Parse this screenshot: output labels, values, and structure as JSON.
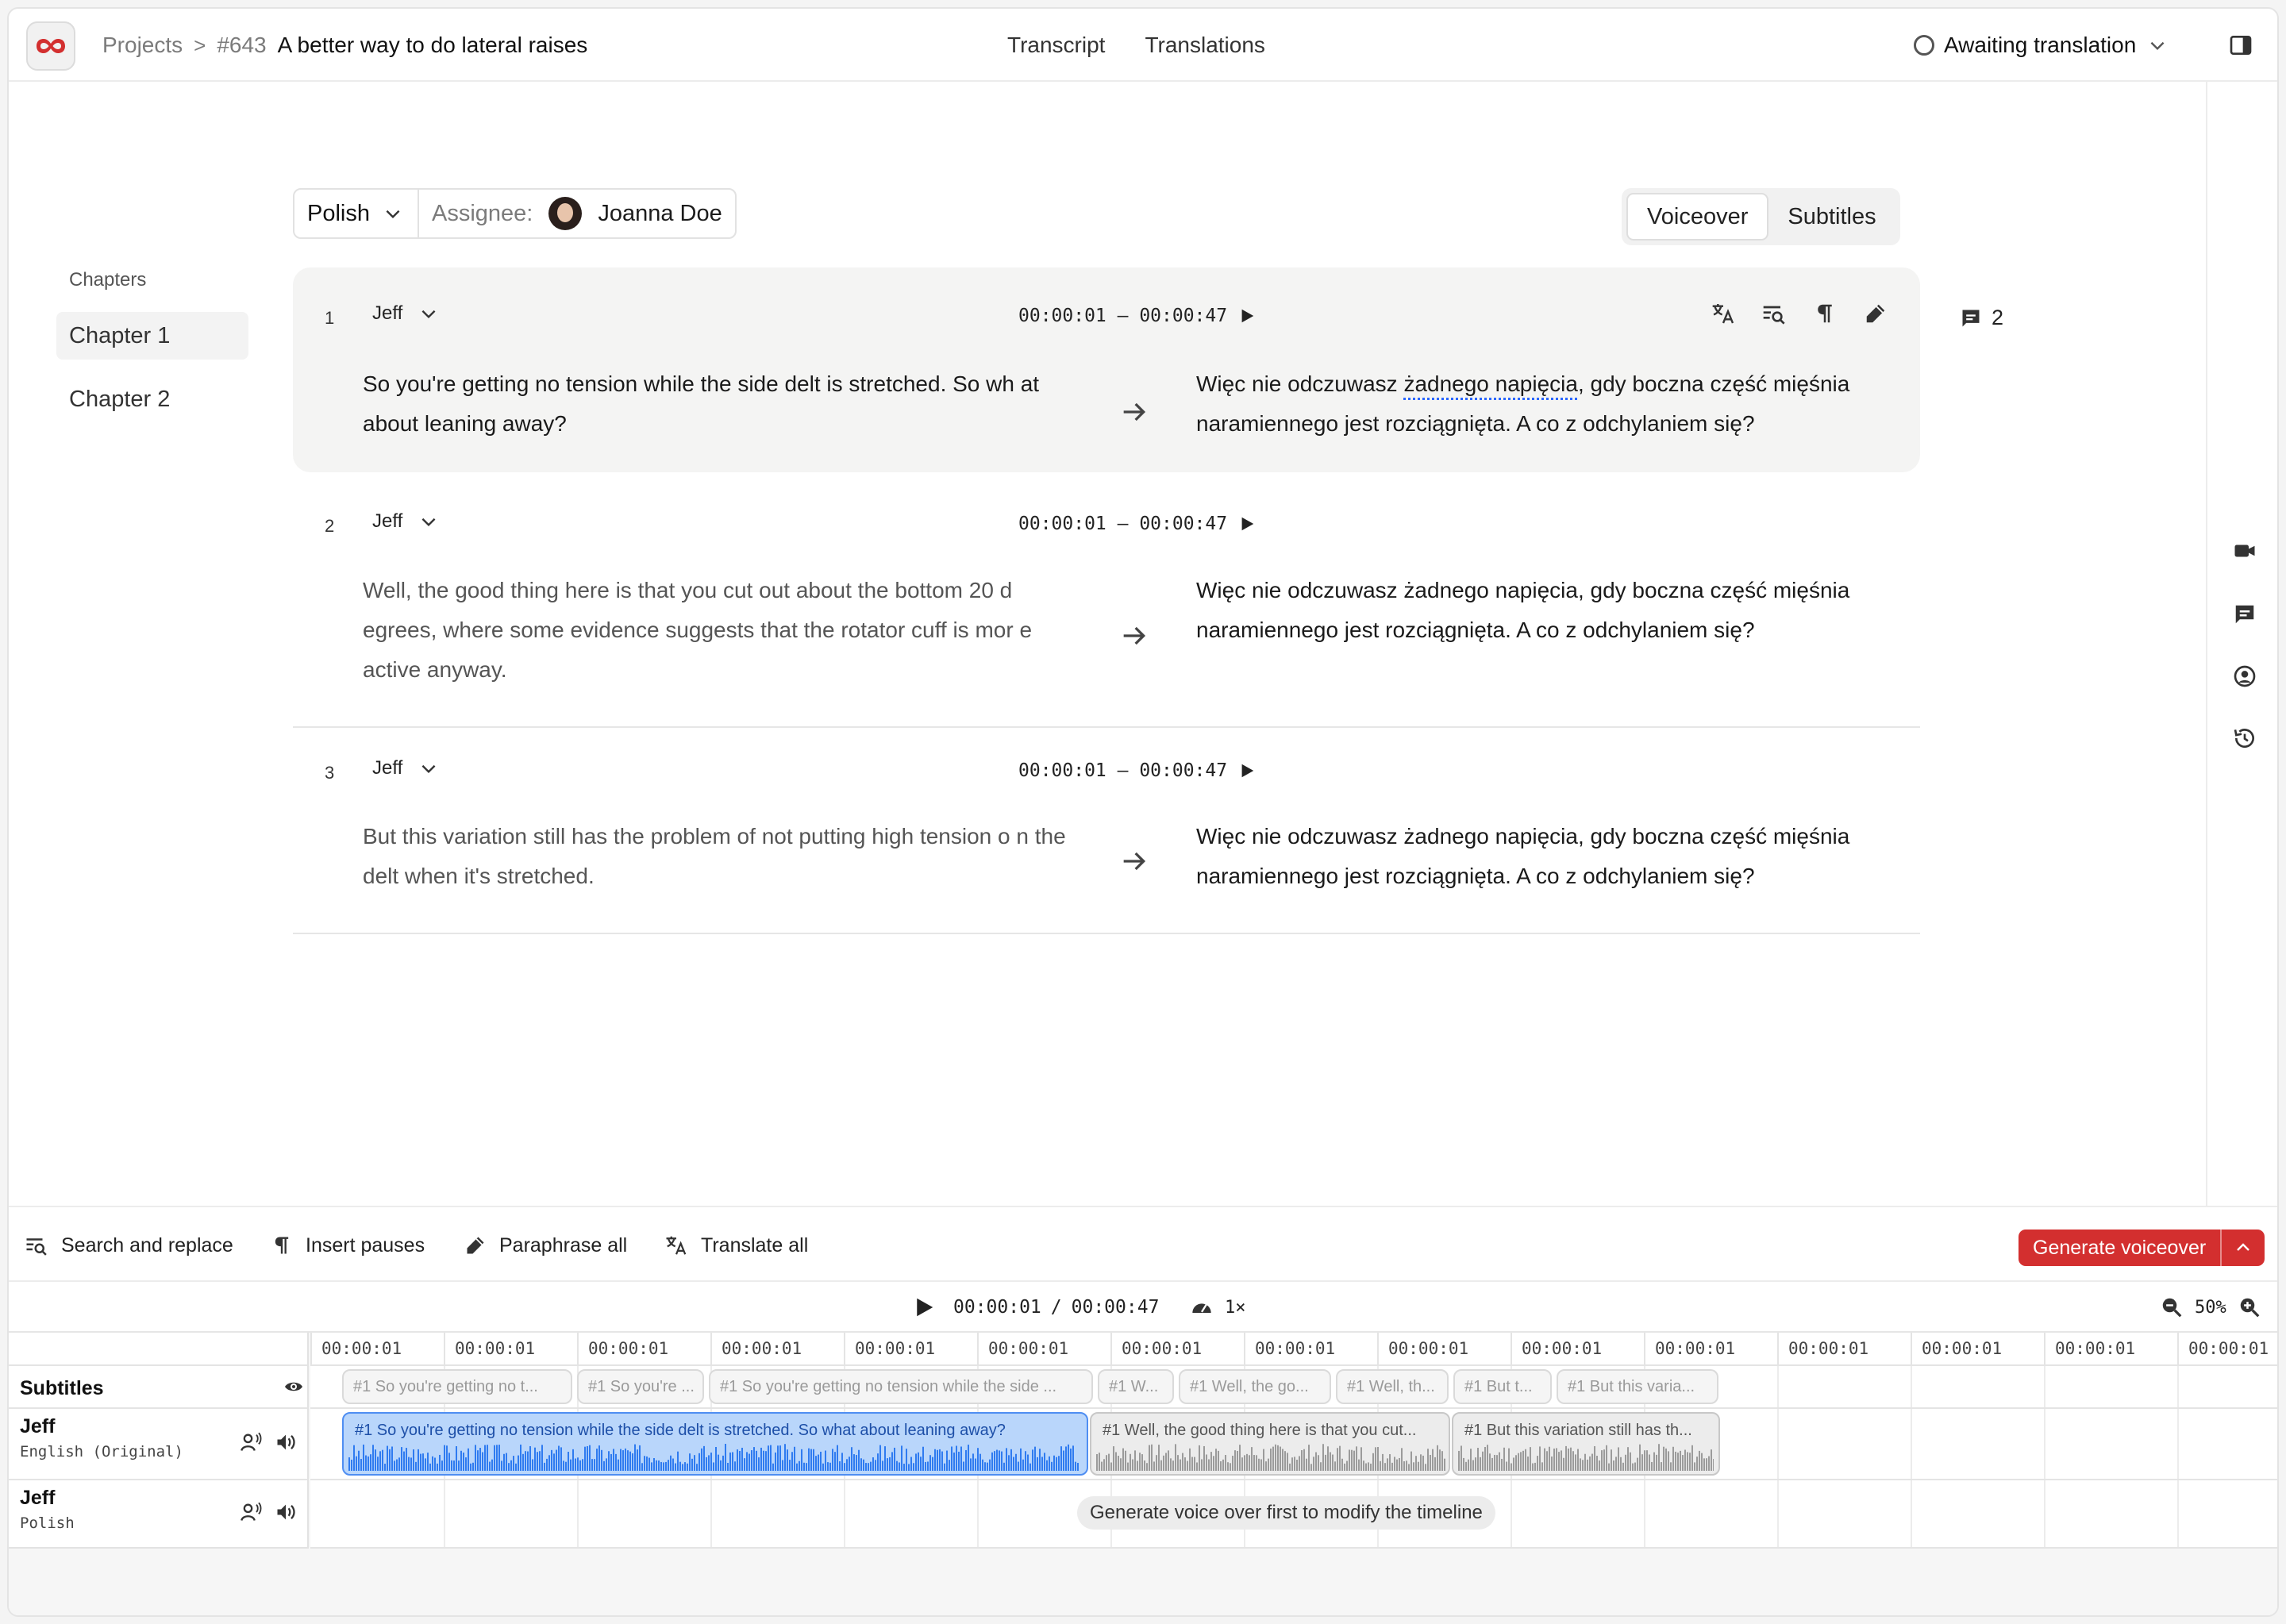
{
  "header": {
    "breadcrumb_root": "Projects",
    "breadcrumb_sep": ">",
    "project_number": "#643",
    "project_title": "A better way to do lateral raises",
    "tabs": [
      "Transcript",
      "Translations"
    ],
    "status": "Awaiting translation"
  },
  "chapters": {
    "title": "Chapters",
    "items": [
      "Chapter 1",
      "Chapter 2"
    ],
    "active": 0
  },
  "toolbar": {
    "language": "Polish",
    "assignee_label": "Assignee:",
    "assignee_name": "Joanna Doe",
    "modes": [
      "Voiceover",
      "Subtitles"
    ],
    "active_mode": "Voiceover"
  },
  "segments": [
    {
      "index": "1",
      "speaker": "Jeff",
      "timecode": "00:00:01 – 00:00:47",
      "source": "So you're getting no tension while the side delt is stretched. So wh at about leaning away?",
      "target_before": "Więc nie odczuwasz ",
      "target_flag": "żadnego napięcia",
      "target_after": ", gdy boczna część mięśnia naramiennego jest rozciągnięta. A co z odchylaniem się?",
      "comment_count": "2"
    },
    {
      "index": "2",
      "speaker": "Jeff",
      "timecode": "00:00:01 – 00:00:47",
      "source": "Well, the good thing here is that you cut out about the bottom 20 d egrees, where some evidence suggests that the rotator cuff is mor e active anyway.",
      "target": "Więc nie odczuwasz żadnego napięcia, gdy boczna część mięśnia naramiennego jest rozciągnięta. A co z odchylaniem się?"
    },
    {
      "index": "3",
      "speaker": "Jeff",
      "timecode": "00:00:01 – 00:00:47",
      "source": "But this variation still has the problem of not putting high tension o n the delt when it's stretched.",
      "target": "Więc nie odczuwasz żadnego napięcia, gdy boczna część mięśnia naramiennego jest rozciągnięta. A co z odchylaniem się?"
    }
  ],
  "bottom_bar": {
    "search_replace": "Search and replace",
    "insert_pauses": "Insert pauses",
    "paraphrase_all": "Paraphrase all",
    "translate_all": "Translate all",
    "generate": "Generate voiceover"
  },
  "transport": {
    "current": "00:00:01",
    "sep": "/",
    "total": "00:00:47",
    "speed": "1×",
    "zoom": "50%"
  },
  "timeline": {
    "ruler": [
      "00:00:01",
      "00:00:01",
      "00:00:01",
      "00:00:01",
      "00:00:01",
      "00:00:01",
      "00:00:01",
      "00:00:01",
      "00:00:01",
      "00:00:01",
      "00:00:01",
      "00:00:01",
      "00:00:01",
      "00:00:01",
      "00:00:01"
    ],
    "subtitles_label": "Subtitles",
    "subtitle_chips": [
      "#1 So you're getting no t...",
      "#1 So you're ...",
      "#1 So you're getting no tension while the side ...",
      "#1 W...",
      "#1 Well, the go...",
      "#1 Well, th...",
      "#1 But t...",
      "#1 But this varia..."
    ],
    "tracks": [
      {
        "name": "Jeff",
        "language": "English (Original)"
      },
      {
        "name": "Jeff",
        "language": "Polish"
      }
    ],
    "audio_clips": [
      "#1 So you're getting no tension while the side delt is stretched. So what about leaning away?",
      "#1 Well, the good thing here is that you cut...",
      "#1 But this variation still has th..."
    ],
    "generate_note": "Generate voice over first to modify the timeline"
  },
  "colors": {
    "brand_red": "#d32f2f",
    "clip_blue": "#b9d6fb",
    "wave_blue": "#2f7bf0"
  }
}
